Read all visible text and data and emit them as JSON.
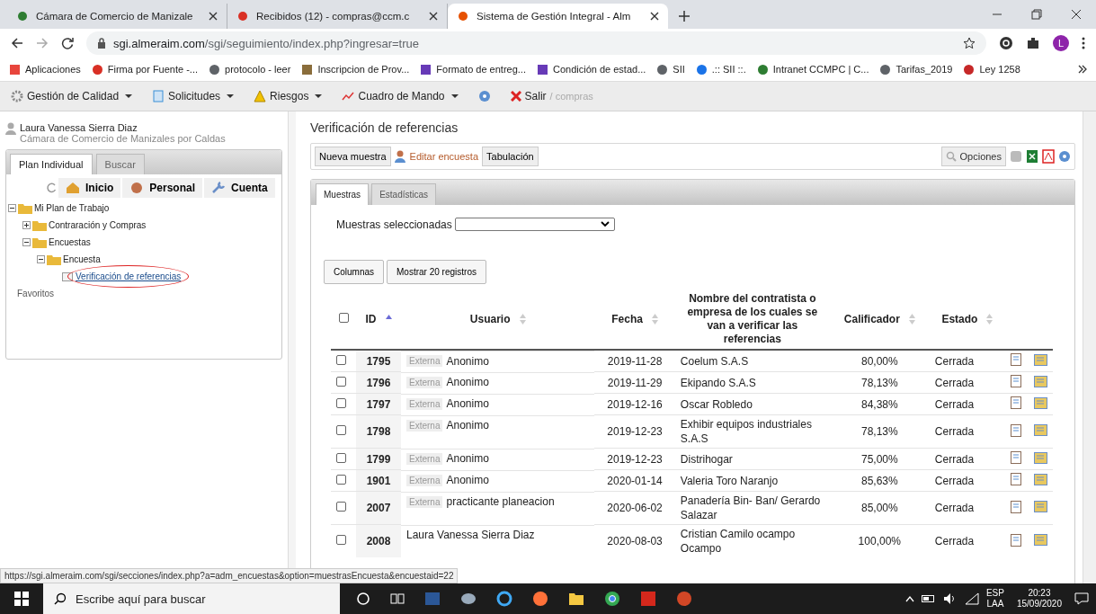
{
  "browser": {
    "tabs": [
      {
        "title": "Cámara de Comercio de Manizale",
        "selected": false
      },
      {
        "title": "Recibidos (12) - compras@ccm.c",
        "selected": false
      },
      {
        "title": "Sistema de Gestión Integral - Alm",
        "selected": true
      }
    ],
    "url_host": "sgi.almeraim.com",
    "url_path": "/sgi/seguimiento/index.php?ingresar=true",
    "profile": "L",
    "bookmarks": [
      {
        "label": "Aplicaciones"
      },
      {
        "label": "Firma por Fuente -..."
      },
      {
        "label": "protocolo - leer"
      },
      {
        "label": "Inscripcion de Prov..."
      },
      {
        "label": "Formato de entreg..."
      },
      {
        "label": "Condición de estad..."
      },
      {
        "label": "SII"
      },
      {
        "label": ".:: SII ::."
      },
      {
        "label": "Intranet CCMPC | C..."
      },
      {
        "label": "Tarifas_2019"
      },
      {
        "label": "Ley 1258"
      }
    ]
  },
  "app_menu": {
    "items": [
      {
        "label": "Gestión de Calidad",
        "dropdown": true
      },
      {
        "label": "Solicitudes",
        "dropdown": true
      },
      {
        "label": "Riesgos",
        "dropdown": true
      },
      {
        "label": "Cuadro de Mando",
        "dropdown": true
      }
    ],
    "logout": "Salir",
    "user_suffix": "/ compras"
  },
  "sidebar": {
    "user_name": "Laura Vanessa Sierra Diaz",
    "organization": "Cámara de Comercio de Manizales por Caldas",
    "tabs": [
      {
        "label": "Plan Individual",
        "selected": true
      },
      {
        "label": "Buscar",
        "selected": false
      }
    ],
    "nav_buttons": [
      {
        "label": "Inicio"
      },
      {
        "label": "Personal"
      },
      {
        "label": "Cuenta"
      }
    ],
    "tree": [
      {
        "label": "Mi Plan de Trabajo",
        "kind": "folder",
        "expanded": true,
        "children": [
          {
            "label": "Contraración y Compras",
            "kind": "folder",
            "expanded": false
          },
          {
            "label": "Encuestas",
            "kind": "folder",
            "expanded": true,
            "children": [
              {
                "label": "Encuesta",
                "kind": "folder",
                "expanded": true,
                "children": [
                  {
                    "label": "Verificación de referencias",
                    "kind": "link",
                    "circled": true
                  }
                ]
              }
            ]
          }
        ]
      },
      {
        "label": "Favoritos",
        "kind": "plain"
      }
    ]
  },
  "main": {
    "title": "Verificación de referencias",
    "toolbar": [
      {
        "label": "Nueva muestra",
        "kind": "button"
      },
      {
        "label": "Editar encuesta",
        "kind": "link"
      },
      {
        "label": "Tabulación",
        "kind": "button"
      }
    ],
    "options_button": "Opciones",
    "tabs": [
      {
        "label": "Muestras",
        "selected": true
      },
      {
        "label": "Estadísticas",
        "selected": false
      }
    ],
    "select_label": "Muestras seleccionadas",
    "table_buttons": [
      "Columnas",
      "Mostrar 20 registros"
    ],
    "table": {
      "select_all_checked": false,
      "columns": [
        {
          "label": "ID",
          "sorted": true
        },
        {
          "label": "Usuario",
          "sorted": false
        },
        {
          "label": "Fecha",
          "sorted": false
        },
        {
          "label": "Nombre del contratista o empresa de los cuales se van a verificar las referencias"
        },
        {
          "label": "Calificador",
          "sorted": false
        },
        {
          "label": "Estado",
          "sorted": false
        }
      ],
      "rows": [
        {
          "checked": false,
          "id": "1795",
          "tag": "Externa",
          "user": "Anonimo",
          "date": "2019-11-28",
          "name": "Coelum S.A.S",
          "score": "80,00%",
          "status": "Cerrada"
        },
        {
          "checked": false,
          "id": "1796",
          "tag": "Externa",
          "user": "Anonimo",
          "date": "2019-11-29",
          "name": "Ekipando S.A.S",
          "score": "78,13%",
          "status": "Cerrada"
        },
        {
          "checked": false,
          "id": "1797",
          "tag": "Externa",
          "user": "Anonimo",
          "date": "2019-12-16",
          "name": "Oscar Robledo",
          "score": "84,38%",
          "status": "Cerrada"
        },
        {
          "checked": false,
          "id": "1798",
          "tag": "Externa",
          "user": "Anonimo",
          "date": "2019-12-23",
          "name": "Exhibir equipos industriales S.A.S",
          "score": "78,13%",
          "status": "Cerrada"
        },
        {
          "checked": false,
          "id": "1799",
          "tag": "Externa",
          "user": "Anonimo",
          "date": "2019-12-23",
          "name": "Distrihogar",
          "score": "75,00%",
          "status": "Cerrada"
        },
        {
          "checked": false,
          "id": "1901",
          "tag": "Externa",
          "user": "Anonimo",
          "date": "2020-01-14",
          "name": "Valeria Toro Naranjo",
          "score": "85,63%",
          "status": "Cerrada"
        },
        {
          "checked": false,
          "id": "2007",
          "tag": "Externa",
          "user": "practicante planeacion",
          "date": "2020-06-02",
          "name": "Panadería Bin- Ban/ Gerardo Salazar",
          "score": "85,00%",
          "status": "Cerrada"
        },
        {
          "checked": false,
          "id": "2008",
          "user": "Laura Vanessa Sierra Diaz",
          "date": "2020-08-03",
          "name": "Cristian Camilo ocampo Ocampo",
          "score": "100,00%",
          "status": "Cerrada"
        }
      ]
    }
  },
  "status_url": "https://sgi.almeraim.com/sgi/secciones/index.php?a=adm_encuestas&option=muestrasEncuesta&encuestaid=22",
  "taskbar": {
    "search_placeholder": "Escribe aquí para buscar",
    "language": "ESP",
    "layout": "LAA",
    "time": "20:23",
    "date": "15/09/2020"
  }
}
